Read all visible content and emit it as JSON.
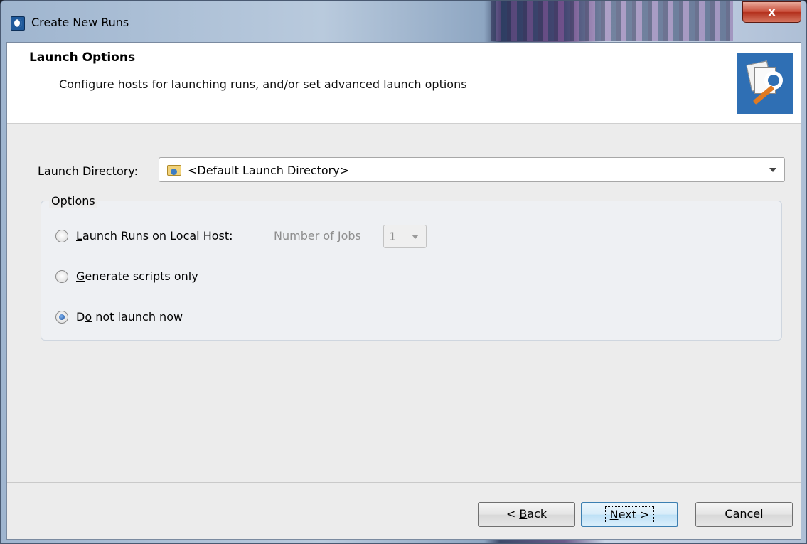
{
  "window": {
    "title": "Create New Runs",
    "close_label": "x"
  },
  "header": {
    "title": "Launch Options",
    "subtitle": "Configure hosts for launching runs, and/or set advanced launch options"
  },
  "launch_directory": {
    "label_pre": "Launch ",
    "label_mnemonic": "D",
    "label_post": "irectory:",
    "value": "<Default Launch Directory>"
  },
  "options": {
    "legend": "Options",
    "local_host": {
      "mnemonic": "L",
      "label_rest": "aunch Runs on Local Host:",
      "checked": false
    },
    "jobs": {
      "label_pre": "Number of ",
      "label_mnemonic": "J",
      "label_post": "obs",
      "value": "1"
    },
    "scripts_only": {
      "mnemonic": "G",
      "label_rest": "enerate scripts only",
      "checked": false
    },
    "do_not_launch": {
      "label_pre": "D",
      "mnemonic": "o",
      "label_rest": " not launch now",
      "checked": true
    }
  },
  "buttons": {
    "back_pre": "< ",
    "back_mnemonic": "B",
    "back_post": "ack",
    "next_mnemonic": "N",
    "next_post": "ext >",
    "cancel": "Cancel"
  }
}
